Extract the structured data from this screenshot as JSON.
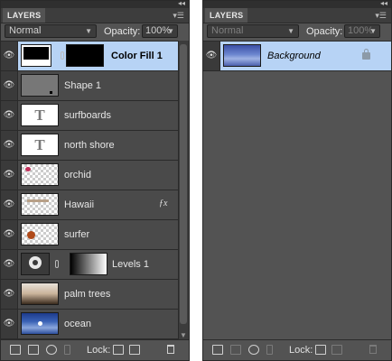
{
  "colors": {
    "panel_bg": "#535353",
    "row_bg": "#4a4a4a",
    "selected_row": "#b7d3f5",
    "header_bg": "#3d3d3d"
  },
  "left_panel": {
    "tab_label": "LAYERS",
    "blend_mode": "Normal",
    "opacity_label": "Opacity:",
    "opacity_value": "100%",
    "lock_label": "Lock:",
    "layers": [
      {
        "name": "Color Fill 1",
        "selected": true,
        "thumb": "black-fill-with-mask",
        "icon": "link-icon"
      },
      {
        "name": "Shape 1",
        "selected": false,
        "thumb": "gray-shape"
      },
      {
        "name": "surfboards",
        "selected": false,
        "thumb": "text-T"
      },
      {
        "name": "north shore",
        "selected": false,
        "thumb": "text-T"
      },
      {
        "name": "orchid",
        "selected": false,
        "thumb": "checker-orchid"
      },
      {
        "name": "Hawaii",
        "selected": false,
        "thumb": "checker-hawaii",
        "icon": "fx-icon"
      },
      {
        "name": "surfer",
        "selected": false,
        "thumb": "checker-surfer"
      },
      {
        "name": "Levels 1",
        "selected": false,
        "thumb": "levels-adjustment",
        "icon": "link-icon"
      },
      {
        "name": "palm trees",
        "selected": false,
        "thumb": "photo-palms"
      },
      {
        "name": "ocean",
        "selected": false,
        "thumb": "photo-ocean"
      }
    ]
  },
  "right_panel": {
    "tab_label": "LAYERS",
    "blend_mode": "Normal",
    "opacity_label": "Opacity:",
    "opacity_value": "100%",
    "lock_label": "Lock:",
    "layers": [
      {
        "name": "Background",
        "selected": true,
        "thumb": "photo-background",
        "icon": "lock-icon"
      }
    ]
  }
}
